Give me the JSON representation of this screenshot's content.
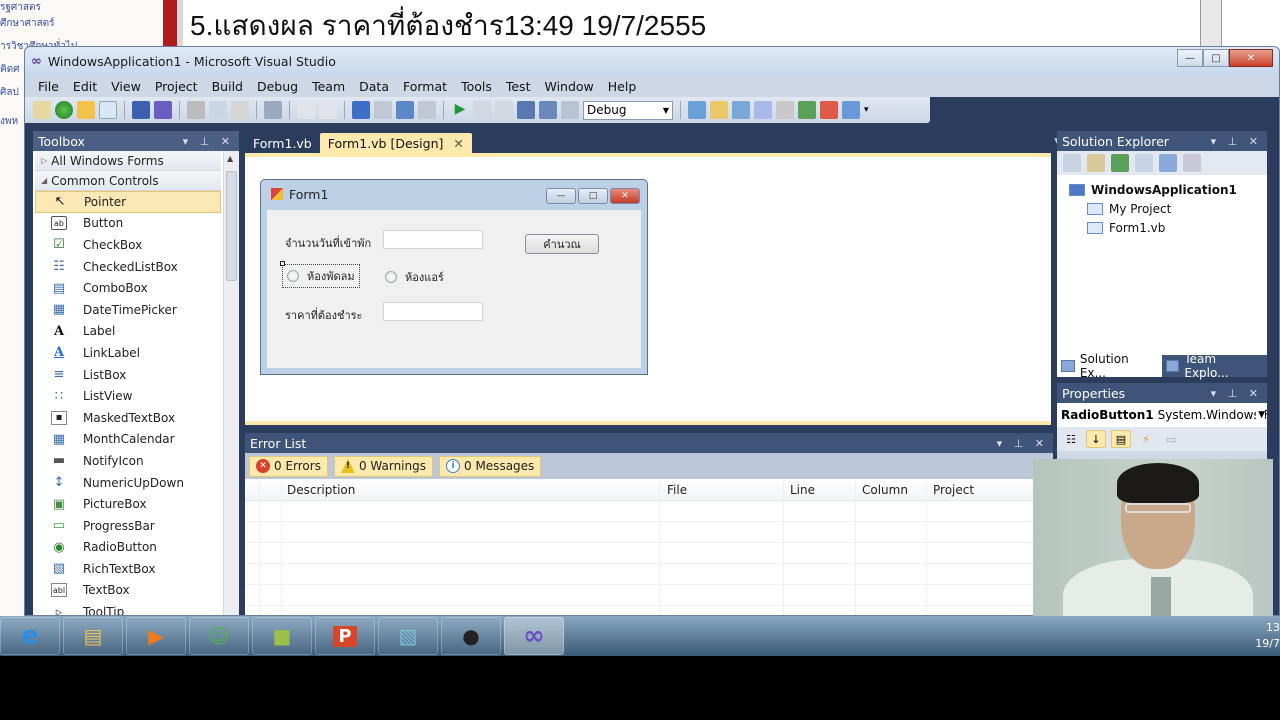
{
  "background": {
    "slide_title": "5.แสดงผล ราคาที่ต้องชำร13:49 19/7/2555",
    "left_links": [
      "รฐศาสตร",
      "ศึกษาศาสตร์",
      "ารวิชาศึกษาทั่วไป",
      "คิดศ",
      "ศิลป",
      "งพห"
    ]
  },
  "window": {
    "title": "WindowsApplication1 - Microsoft Visual Studio",
    "logo_icon": "infinity-icon",
    "controls": {
      "minimize": "—",
      "maximize": "□",
      "close": "✕"
    }
  },
  "menu": [
    "File",
    "Edit",
    "View",
    "Project",
    "Build",
    "Debug",
    "Team",
    "Data",
    "Format",
    "Tools",
    "Test",
    "Window",
    "Help"
  ],
  "toolbar": {
    "configuration": "Debug",
    "icons": [
      "new-project-icon",
      "add-item-icon",
      "open-file-icon",
      "add-new-icon",
      "save-icon",
      "save-all-icon",
      "cut-icon",
      "copy-icon",
      "paste-icon",
      "find-icon",
      "comment-icon",
      "uncomment-icon",
      "undo-icon",
      "redo-icon",
      "navigate-back-icon",
      "navigate-forward-icon",
      "start-icon",
      "pause-icon",
      "stop-icon",
      "step-into-icon",
      "step-over-icon",
      "step-out-icon"
    ],
    "right_icons": [
      "find-in-files-icon",
      "properties-window-icon",
      "object-browser-icon",
      "toolbox-icon",
      "extension-manager-icon",
      "class-view-icon",
      "error-list-icon",
      "command-window-icon"
    ]
  },
  "toolbox": {
    "title": "Toolbox",
    "categories": [
      {
        "label": "All Windows Forms",
        "expanded": false
      },
      {
        "label": "Common Controls",
        "expanded": true
      }
    ],
    "items": [
      {
        "label": "Pointer",
        "icon": "↖",
        "selected": true
      },
      {
        "label": "Button",
        "icon": "ab"
      },
      {
        "label": "CheckBox",
        "icon": "☑"
      },
      {
        "label": "CheckedListBox",
        "icon": "☷"
      },
      {
        "label": "ComboBox",
        "icon": "▤"
      },
      {
        "label": "DateTimePicker",
        "icon": "▦"
      },
      {
        "label": "Label",
        "icon": "A"
      },
      {
        "label": "LinkLabel",
        "icon": "A"
      },
      {
        "label": "ListBox",
        "icon": "≡"
      },
      {
        "label": "ListView",
        "icon": "∷"
      },
      {
        "label": "MaskedTextBox",
        "icon": "▪"
      },
      {
        "label": "MonthCalendar",
        "icon": "▦"
      },
      {
        "label": "NotifyIcon",
        "icon": "▬"
      },
      {
        "label": "NumericUpDown",
        "icon": "↕"
      },
      {
        "label": "PictureBox",
        "icon": "▣"
      },
      {
        "label": "ProgressBar",
        "icon": "▭"
      },
      {
        "label": "RadioButton",
        "icon": "◉"
      },
      {
        "label": "RichTextBox",
        "icon": "▧"
      },
      {
        "label": "TextBox",
        "icon": "abl"
      },
      {
        "label": "ToolTip",
        "icon": "▹"
      }
    ]
  },
  "doc_tabs": [
    {
      "label": "Form1.vb",
      "active": false
    },
    {
      "label": "Form1.vb [Design]",
      "active": true,
      "close": "✕"
    }
  ],
  "form1": {
    "title": "Form1",
    "label_days": "จำนวนวันที่เข้าพัก",
    "input_days": "",
    "button_calc": "คำนวณ",
    "radio_fan": "ห้องพัดลม",
    "radio_air": "ห้องแอร์",
    "label_price": "ราคาที่ต้องชำระ",
    "input_price": ""
  },
  "error_list": {
    "title": "Error List",
    "filters": [
      {
        "label": "0 Errors",
        "icon": "error-icon",
        "color": "#d9412a"
      },
      {
        "label": "0 Warnings",
        "icon": "warning-icon",
        "color": "#e8c21c"
      },
      {
        "label": "0 Messages",
        "icon": "info-icon",
        "color": "#3d7fd6"
      }
    ],
    "columns": [
      "Description",
      "File",
      "Line",
      "Column",
      "Project"
    ],
    "rows": []
  },
  "solution_explorer": {
    "title": "Solution Explorer",
    "root": "WindowsApplication1",
    "children": [
      "My Project",
      "Form1.vb"
    ],
    "bottom_tabs": [
      {
        "label": "Solution Ex...",
        "active": true
      },
      {
        "label": "Team Explo...",
        "active": false
      }
    ]
  },
  "properties": {
    "title": "Properties",
    "object_name": "RadioButton1",
    "object_type": "System.Windows.Fc"
  },
  "taskbar": {
    "apps": [
      {
        "name": "internet-explorer",
        "glyph": "e",
        "color": "#2b8ee0"
      },
      {
        "name": "windows-explorer",
        "glyph": "▤",
        "color": "#e8c05a"
      },
      {
        "name": "media-player",
        "glyph": "▶",
        "color": "#ef7b1a"
      },
      {
        "name": "messenger",
        "glyph": "☺",
        "color": "#4fb04f"
      },
      {
        "name": "camtasia",
        "glyph": "■",
        "color": "#9bbf4a"
      },
      {
        "name": "powerpoint",
        "glyph": "P",
        "color": "#d8462a"
      },
      {
        "name": "notepad",
        "glyph": "▧",
        "color": "#7ac0d8"
      },
      {
        "name": "webcam-recorder",
        "glyph": "●",
        "color": "#333"
      },
      {
        "name": "visual-studio",
        "glyph": "∞",
        "color": "#6a4fc0",
        "active": true
      }
    ],
    "clock_time": "13",
    "clock_date": "19/7"
  },
  "colors": {
    "vs_chrome": "#2b3c5c",
    "active_tab": "#fde9ab",
    "selection": "#fbe8b4"
  }
}
